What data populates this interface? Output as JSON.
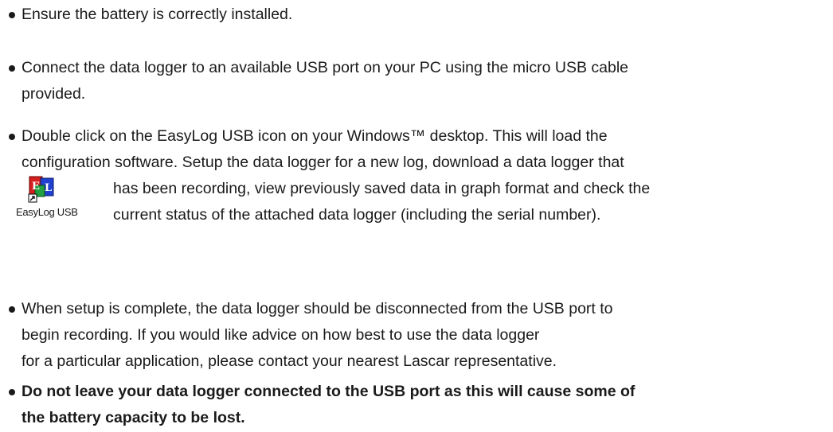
{
  "bullets": [
    {
      "lines": [
        "Ensure the battery is correctly installed."
      ]
    },
    {
      "lines": [
        "Connect the data logger to an available USB port on your PC using the micro USB cable",
        "provided."
      ]
    },
    {
      "lines": [
        "Double click on the EasyLog USB icon on your Windows™ desktop. This will load the",
        "configuration software. Setup the data logger for a new log, download a data logger that",
        "has been recording, view previously saved data in graph format and check the",
        "current status of the attached data logger (including the serial number)."
      ]
    },
    {
      "lines": [
        "When setup is complete, the data logger should be disconnected from the USB port to",
        "begin recording. If you would like advice on how best to use the data logger",
        "for a particular application, please contact your nearest Lascar representative."
      ]
    },
    {
      "lines": [
        "Do not leave your data logger connected to the USB port as this will cause some of",
        "the battery capacity to be lost."
      ]
    }
  ],
  "desktop_icon": {
    "icon_name": "easylog-usb-desktop-icon",
    "caption": "EasyLog USB",
    "colors": {
      "red_tile": "#d42020",
      "blue_tile": "#2040d0",
      "green_tile": "#20a040"
    }
  }
}
